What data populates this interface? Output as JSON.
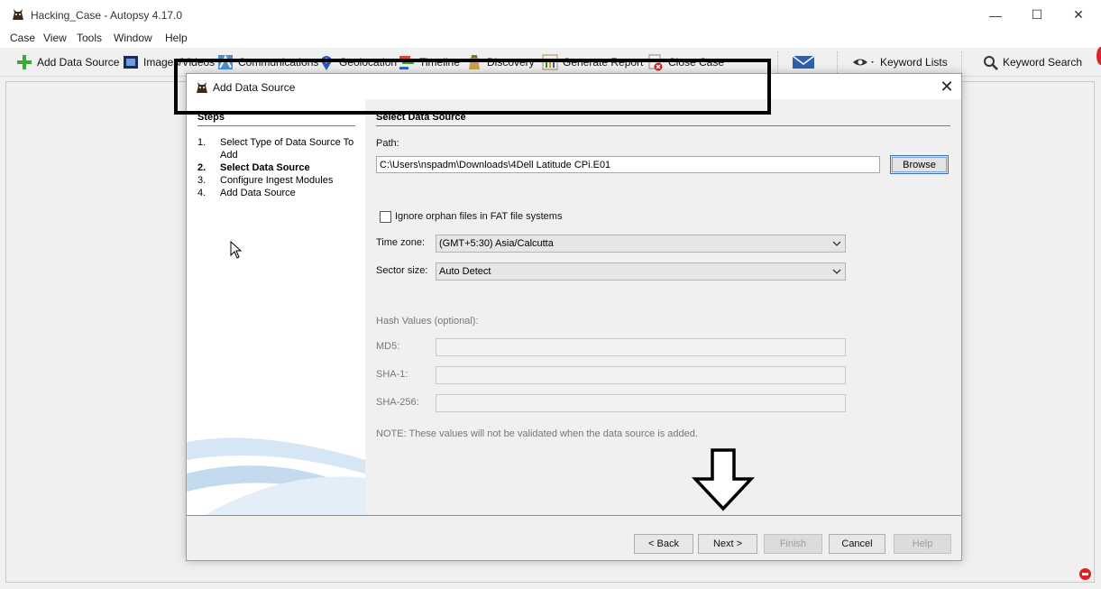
{
  "window": {
    "title": "Hacking_Case - Autopsy 4.17.0",
    "minimize_glyph": "—",
    "maximize_glyph": "☐",
    "close_glyph": "✕"
  },
  "menu": [
    "Case",
    "View",
    "Tools",
    "Window",
    "Help"
  ],
  "toolbar": {
    "add_data_source": "Add Data Source",
    "images_videos": "Images/Videos",
    "communications": "Communications",
    "geolocation": "Geolocation",
    "timeline": "Timeline",
    "discovery": "Discovery",
    "generate_report": "Generate Report",
    "close_case": "Close Case",
    "keyword_lists": "Keyword Lists",
    "keyword_search": "Keyword Search"
  },
  "dialog": {
    "title": "Add Data Source",
    "close_glyph": "✕",
    "steps_heading": "Steps",
    "steps": [
      {
        "num": "1.",
        "label": "Select Type of Data Source To Add"
      },
      {
        "num": "2.",
        "label": "Select Data Source"
      },
      {
        "num": "3.",
        "label": "Configure Ingest Modules"
      },
      {
        "num": "4.",
        "label": "Add Data Source"
      }
    ],
    "heading": "Select Data Source",
    "path_label": "Path:",
    "path_value": "C:\\Users\\nspadm\\Downloads\\4Dell Latitude CPi.E01",
    "browse": "Browse",
    "ignore_orphan": "Ignore orphan files in FAT file systems",
    "timezone_label": "Time zone:",
    "timezone_value": "(GMT+5:30) Asia/Calcutta",
    "sector_label": "Sector size:",
    "sector_value": "Auto Detect",
    "hash_heading": "Hash Values (optional):",
    "md5_label": "MD5:",
    "sha1_label": "SHA-1:",
    "sha256_label": "SHA-256:",
    "note": "NOTE: These values will not be validated when the data source is added.",
    "buttons": {
      "back": "< Back",
      "next": "Next >",
      "finish": "Finish",
      "cancel": "Cancel",
      "help": "Help"
    }
  },
  "colors": {
    "accent_blue": "#3b6fb6",
    "highlight_border": "#000000"
  }
}
